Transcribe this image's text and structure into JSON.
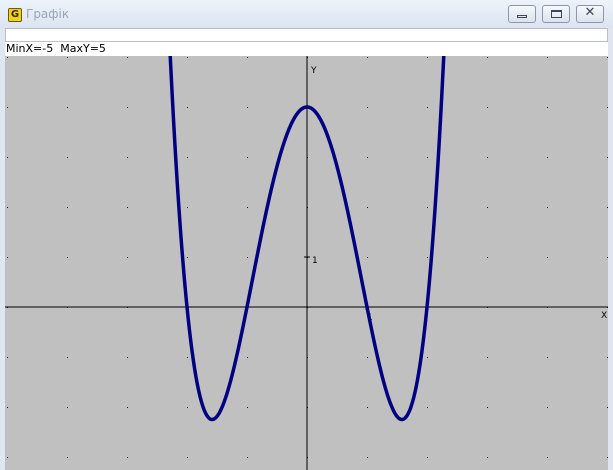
{
  "window": {
    "title": "Графік",
    "app_icon_letter": "G"
  },
  "status": {
    "text": "MinX=-5  MaxY=5"
  },
  "colors": {
    "plot_background": "#c0c0c0",
    "curve": "#000080",
    "axis": "#000000"
  },
  "chart_data": {
    "type": "line",
    "function": "(x^2-1)(x^2-4)",
    "xlabel": "X",
    "ylabel": "Y",
    "xlim": [
      -5,
      5
    ],
    "ylim": [
      -3,
      5
    ],
    "x_tick_label": "1",
    "y_tick_label": "1",
    "grid": "dotted",
    "series": [
      {
        "x": [
          -2.3,
          -2.2,
          -2.1,
          -2.0,
          -1.9,
          -1.8,
          -1.7,
          -1.6,
          -1.5,
          -1.4,
          -1.3,
          -1.2,
          -1.1,
          -1.0,
          -0.9,
          -0.8,
          -0.7,
          -0.6,
          -0.5,
          -0.4,
          -0.3,
          -0.2,
          -0.1,
          0.0,
          0.1,
          0.2,
          0.3,
          0.4,
          0.5,
          0.6,
          0.7,
          0.8,
          0.9,
          1.0,
          1.1,
          1.2,
          1.3,
          1.4,
          1.5,
          1.6,
          1.7,
          1.8,
          1.9,
          2.0,
          2.1,
          2.2,
          2.3
        ],
        "y": [
          5.1,
          3.29,
          1.85,
          0.0,
          -1.02,
          -1.75,
          -2.21,
          -2.45,
          -2.19,
          -1.96,
          -1.53,
          -1.08,
          -0.6,
          0.0,
          0.62,
          1.22,
          1.77,
          2.24,
          2.81,
          3.2,
          3.55,
          3.81,
          3.96,
          4.0,
          3.96,
          3.81,
          3.55,
          3.2,
          2.81,
          2.24,
          1.77,
          1.22,
          0.62,
          0.0,
          -0.6,
          -1.08,
          -1.53,
          -1.96,
          -2.19,
          -2.45,
          -2.21,
          -1.75,
          -1.02,
          0.0,
          1.85,
          3.29,
          5.1
        ]
      }
    ]
  }
}
